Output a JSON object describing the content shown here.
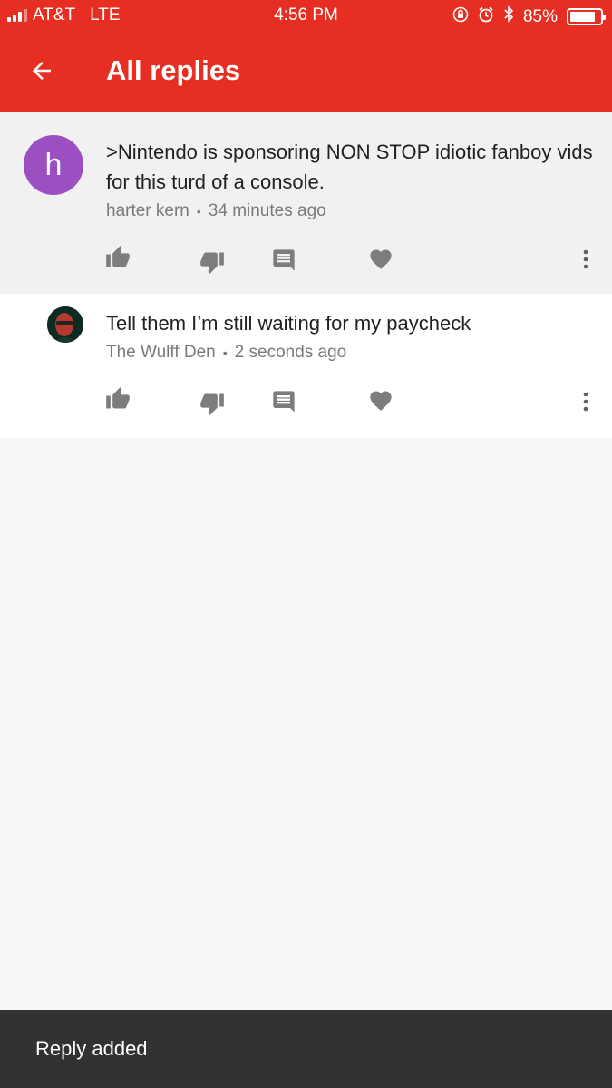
{
  "status_bar": {
    "carrier": "AT&T",
    "network": "LTE",
    "time": "4:56 PM",
    "battery": "85%",
    "battery_level": 0.85
  },
  "app_bar": {
    "title": "All replies",
    "back_icon": "arrow-back-icon"
  },
  "colors": {
    "brand": "#e62f22",
    "avatar_h": "#9b4fc1",
    "snackbar": "#323232"
  },
  "comments": [
    {
      "avatar_letter": "h",
      "text": ">Nintendo is sponsoring NON STOP idiotic fanboy vids for this turd of  a console.",
      "author": "harter kern",
      "time": "34 minutes ago"
    },
    {
      "avatar_letter": "",
      "text": "Tell them I’m still waiting for my paycheck",
      "author": "The Wulff Den",
      "time": "2 seconds ago"
    }
  ],
  "snackbar": {
    "message": "Reply added"
  }
}
